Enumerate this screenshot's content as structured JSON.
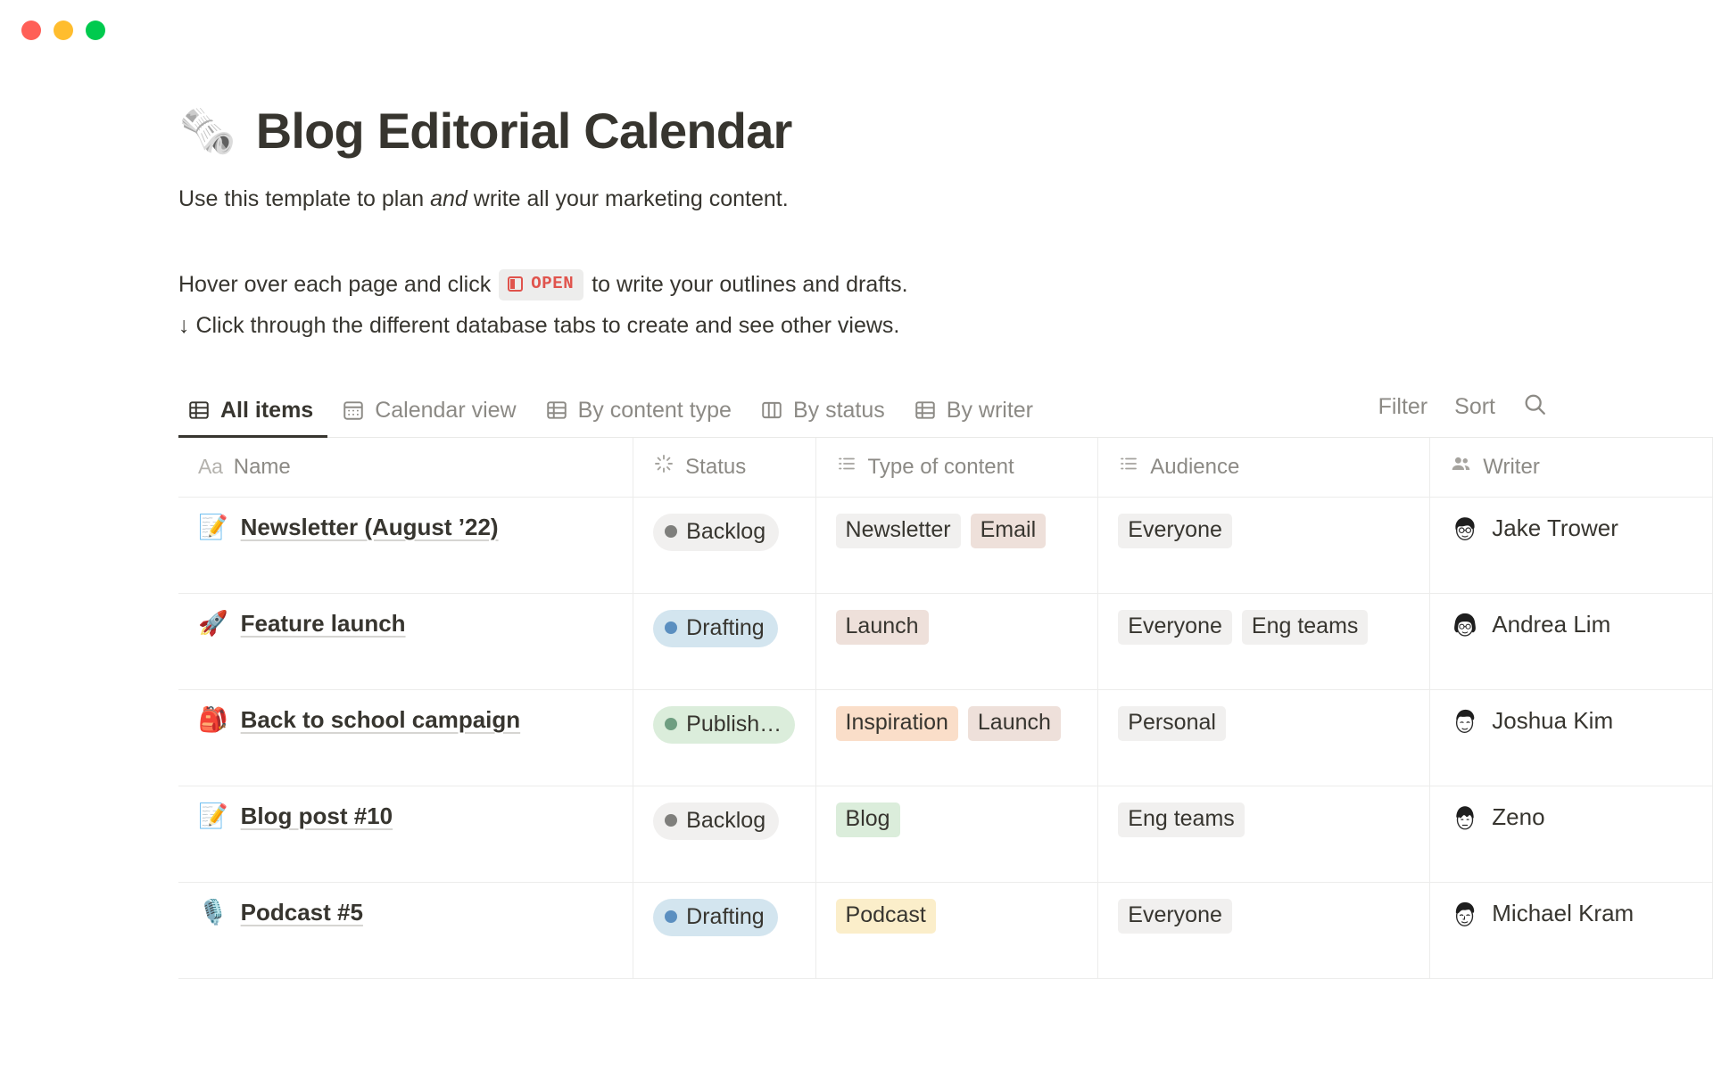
{
  "window": {
    "controls": [
      {
        "name": "close",
        "color": "#ff5f57"
      },
      {
        "name": "minimize",
        "color": "#ffbd2e"
      },
      {
        "name": "zoom",
        "color": "#00ca4e"
      }
    ]
  },
  "header": {
    "emoji": "🗞️",
    "title": "Blog Editorial Calendar",
    "intro_before": "Use this template to plan ",
    "intro_em": "and",
    "intro_after": " write all your marketing content.",
    "howto_line1_before": "Hover over each page and click ",
    "open_chip_label": "OPEN",
    "howto_line1_after": " to write your outlines and drafts.",
    "howto_line2": "↓ Click through the different database tabs to create and see other views."
  },
  "tabs": [
    {
      "label": "All items",
      "icon": "table-icon",
      "active": true
    },
    {
      "label": "Calendar view",
      "icon": "calendar-icon",
      "active": false
    },
    {
      "label": "By content type",
      "icon": "table-icon",
      "active": false
    },
    {
      "label": "By status",
      "icon": "board-icon",
      "active": false
    },
    {
      "label": "By writer",
      "icon": "table-icon",
      "active": false
    }
  ],
  "toolbar": {
    "filter_label": "Filter",
    "sort_label": "Sort",
    "search_icon": "search-icon"
  },
  "table": {
    "columns": [
      {
        "label": "Name",
        "icon": "title-aa-icon"
      },
      {
        "label": "Status",
        "icon": "status-spinner-icon"
      },
      {
        "label": "Type of content",
        "icon": "multiselect-icon"
      },
      {
        "label": "Audience",
        "icon": "multiselect-icon"
      },
      {
        "label": "Writer",
        "icon": "people-icon"
      }
    ],
    "rows": [
      {
        "emoji": "📝",
        "name": "Newsletter (August ’22)",
        "status": {
          "label": "Backlog",
          "dot": "#7f7f7c",
          "bg": "#f1f0ef"
        },
        "type": [
          {
            "label": "Newsletter",
            "bg": "#f1f0ef"
          },
          {
            "label": "Email",
            "bg": "#eee0da"
          }
        ],
        "audience": [
          {
            "label": "Everyone",
            "bg": "#f1f0ef"
          }
        ],
        "writer": {
          "name": "Jake Trower",
          "avatar": "avatar-glasses-male"
        }
      },
      {
        "emoji": "🚀",
        "name": "Feature launch",
        "status": {
          "label": "Drafting",
          "dot": "#5b8fc0",
          "bg": "#d3e5ef"
        },
        "type": [
          {
            "label": "Launch",
            "bg": "#eee0da"
          }
        ],
        "audience": [
          {
            "label": "Everyone",
            "bg": "#f1f0ef"
          },
          {
            "label": "Eng teams",
            "bg": "#f1f0ef"
          }
        ],
        "writer": {
          "name": "Andrea Lim",
          "avatar": "avatar-bob-female"
        }
      },
      {
        "emoji": "🎒",
        "name": "Back to school campaign",
        "status": {
          "label": "Publish…",
          "dot": "#6f9e81",
          "bg": "#dbeddb"
        },
        "type": [
          {
            "label": "Inspiration",
            "bg": "#fadec9"
          },
          {
            "label": "Launch",
            "bg": "#eee0da"
          }
        ],
        "audience": [
          {
            "label": "Personal",
            "bg": "#f1f0ef"
          }
        ],
        "writer": {
          "name": "Joshua Kim",
          "avatar": "avatar-short-male"
        }
      },
      {
        "emoji": "📝",
        "name": "Blog post #10",
        "status": {
          "label": "Backlog",
          "dot": "#7f7f7c",
          "bg": "#f1f0ef"
        },
        "type": [
          {
            "label": "Blog",
            "bg": "#dbeddb"
          }
        ],
        "audience": [
          {
            "label": "Eng teams",
            "bg": "#f1f0ef"
          }
        ],
        "writer": {
          "name": "Zeno",
          "avatar": "avatar-bowl-cut"
        }
      },
      {
        "emoji": "🎙️",
        "name": "Podcast #5",
        "status": {
          "label": "Drafting",
          "dot": "#5b8fc0",
          "bg": "#d3e5ef"
        },
        "type": [
          {
            "label": "Podcast",
            "bg": "#fbeeca"
          }
        ],
        "audience": [
          {
            "label": "Everyone",
            "bg": "#f1f0ef"
          }
        ],
        "writer": {
          "name": "Michael Kram",
          "avatar": "avatar-wavy-male"
        }
      }
    ]
  }
}
